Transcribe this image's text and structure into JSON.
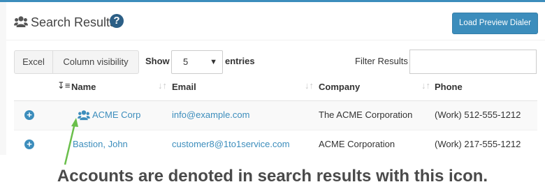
{
  "header": {
    "title": "Search Results",
    "help_icon": "question-circle-icon",
    "title_icon": "users-icon",
    "dialer_button": "Load Preview Dialer"
  },
  "toolbar": {
    "excel": "Excel",
    "column_visibility": "Column visibility",
    "show_label": "Show",
    "page_size": "5",
    "entries_label": "entries",
    "filter_label": "Filter Results",
    "filter_value": ""
  },
  "table": {
    "columns": [
      "Name",
      "Email",
      "Company",
      "Phone"
    ],
    "rows": [
      {
        "name": "ACME Corp",
        "email": "info@example.com",
        "company": "The ACME Corporation",
        "phone": "(Work) 512-555-1212",
        "is_account": true
      },
      {
        "name": "Bastion, John",
        "email": "customer8@1to1service.com",
        "company": "ACME Corporation",
        "phone": "(Work) 217-555-1212",
        "is_account": false
      }
    ]
  },
  "annotation": {
    "caption": "Accounts are denoted in search results with this icon.",
    "arrow_color": "#6abf4b"
  },
  "colors": {
    "accent": "#3c8dbc",
    "help": "#2c5f86"
  }
}
